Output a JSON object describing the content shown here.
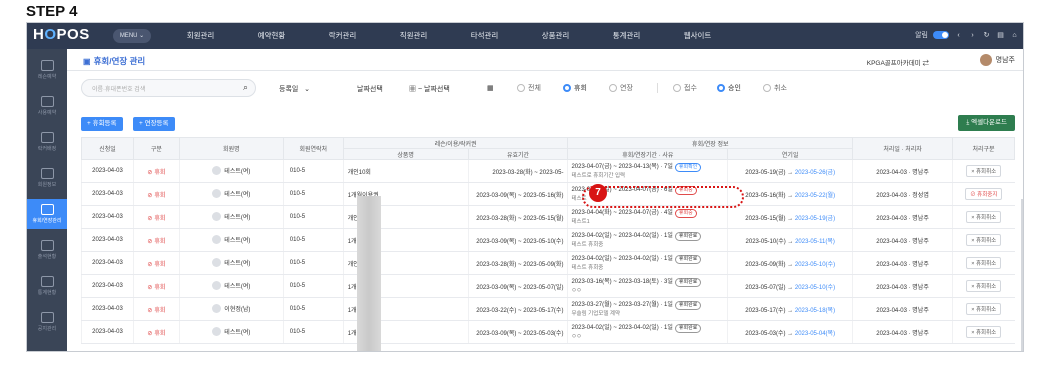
{
  "step_label": "STEP 4",
  "header": {
    "logo": "HOPOS",
    "menu_label": "MENU",
    "nav": [
      "회원관리",
      "예약현황",
      "락커관리",
      "직원관리",
      "타석관리",
      "상품관리",
      "통계관리",
      "웹사이트"
    ],
    "toggle_label": "알림"
  },
  "sidebar": {
    "items": [
      {
        "label": "레슨예약",
        "icon": "calendar-icon"
      },
      {
        "label": "사용예약",
        "icon": "document-icon"
      },
      {
        "label": "락커배정",
        "icon": "locker-icon"
      },
      {
        "label": "회원정보",
        "icon": "member-icon"
      },
      {
        "label": "휴회/연장관리",
        "icon": "pause-calendar-icon",
        "active": true
      },
      {
        "label": "출석현황",
        "icon": "check-icon"
      },
      {
        "label": "통계현황",
        "icon": "chart-icon"
      },
      {
        "label": "공지관리",
        "icon": "board-icon"
      },
      {
        "label": "문자관리",
        "icon": "megaphone-icon"
      }
    ]
  },
  "page": {
    "title": "휴회/연장 관리",
    "academy": "KPGA골프아카데미",
    "user": "명남주"
  },
  "filters": {
    "search_placeholder": "이름·휴대폰번호 검색",
    "sort": "등록일",
    "date_start": "날짜선택",
    "date_sep": "~",
    "date_end": "날짜선택",
    "type_options": [
      "전체",
      "휴회",
      "연장"
    ],
    "type_selected": "휴회",
    "status_options": [
      "접수",
      "승인",
      "취소"
    ],
    "status_selected": "승인"
  },
  "buttons": {
    "add_pause": "+ 휴회등록",
    "add_extend": "+ 연장등록",
    "excel": "엑셀다운로드"
  },
  "table": {
    "group_headers": {
      "lesson": "레슨/이용/락커권",
      "pause": "휴회/연장 정보"
    },
    "headers": [
      "신청일",
      "구분",
      "회원명",
      "회원연락처",
      "상품명",
      "유효기간",
      "휴회/연장기간 · 사유",
      "연기일",
      "처리일 · 처리자",
      "처리구분"
    ],
    "rows": [
      {
        "date": "2023-04-03",
        "type": "휴회",
        "member": "테스트(여)",
        "phone": "010-5",
        "product": "개인10회",
        "validity": "2023-03-28(화) ~ 2023-05-",
        "period": "2023-04-07(금) ~ 2023-04-13(목) · 7일",
        "chip": "휴회확인",
        "chip_color": "blue",
        "reason": "테스트로 휴회기간 입력",
        "postpone": "2023-05-19(금)",
        "postpone_to": "2023-05-26(금)",
        "processed": "2023-04-03 · 명남주",
        "action": "휴회취소",
        "stop": false
      },
      {
        "date": "2023-04-03",
        "type": "휴회",
        "member": "테스트(여)",
        "phone": "010-5",
        "product": "1개월이용권",
        "validity": "2023-03-09(목) ~ 2023-05-16(화)",
        "period": "2023-04-02(일) ~ 2023-04-07(금) · 6일",
        "chip": "휴회중",
        "chip_color": "red",
        "reason": "테스트",
        "postpone": "2023-05-16(화)",
        "postpone_to": "2023-05-22(월)",
        "processed": "2023-04-03 · 정성엽",
        "action": "휴회중지",
        "stop": true
      },
      {
        "date": "2023-04-03",
        "type": "휴회",
        "member": "테스트(여)",
        "phone": "010-5",
        "product": "개인10회",
        "validity": "2023-03-28(화) ~ 2023-05-15(월)",
        "period": "2023-04-04(화) ~ 2023-04-07(금) · 4일",
        "chip": "휴회중",
        "chip_color": "red",
        "reason": "테스트1",
        "postpone": "2023-05-15(월)",
        "postpone_to": "2023-05-19(금)",
        "processed": "2023-04-03 · 명남주",
        "action": "휴회취소",
        "stop": false
      },
      {
        "date": "2023-04-03",
        "type": "휴회",
        "member": "테스트(여)",
        "phone": "010-5",
        "product": "1개월이용권",
        "validity": "2023-03-09(목) ~ 2023-05-10(수)",
        "period": "2023-04-02(일) ~ 2023-04-02(일) · 1일",
        "chip": "휴회완료",
        "chip_color": "gray",
        "reason": "테스트 휴회중",
        "postpone": "2023-05-10(수)",
        "postpone_to": "2023-05-11(목)",
        "processed": "2023-04-03 · 명남주",
        "action": "휴회취소",
        "stop": false
      },
      {
        "date": "2023-04-03",
        "type": "휴회",
        "member": "테스트(여)",
        "phone": "010-5",
        "product": "개인10회",
        "validity": "2023-03-28(화) ~ 2023-05-09(화)",
        "period": "2023-04-02(일) ~ 2023-04-02(일) · 1일",
        "chip": "휴회완료",
        "chip_color": "gray",
        "reason": "테스트 휴회중",
        "postpone": "2023-05-09(화)",
        "postpone_to": "2023-05-10(수)",
        "processed": "2023-04-03 · 명남주",
        "action": "휴회취소",
        "stop": false
      },
      {
        "date": "2023-04-03",
        "type": "휴회",
        "member": "테스트(여)",
        "phone": "010-5",
        "product": "1개월이용권",
        "validity": "2023-03-09(목) ~ 2023-05-07(일)",
        "period": "2023-03-16(목) ~ 2023-03-18(토) · 3일",
        "chip": "휴회완료",
        "chip_color": "gray",
        "reason": "ㅇㅇ",
        "postpone": "2023-05-07(일)",
        "postpone_to": "2023-05-10(수)",
        "processed": "2023-04-03 · 명남주",
        "action": "휴회취소",
        "stop": false
      },
      {
        "date": "2023-04-03",
        "type": "휴회",
        "member": "이현정(남)",
        "phone": "010-5",
        "product": "1개월이용권",
        "validity": "2023-03-22(수) ~ 2023-05-17(수)",
        "period": "2023-03-27(월) ~ 2023-03-27(월) · 1일",
        "chip": "휴회완료",
        "chip_color": "gray",
        "reason": "무슬림 기업모델 계약",
        "postpone": "2023-05-17(수)",
        "postpone_to": "2023-05-18(목)",
        "processed": "2023-04-03 · 명남주",
        "action": "휴회취소",
        "stop": false
      },
      {
        "date": "2023-04-03",
        "type": "휴회",
        "member": "테스트(여)",
        "phone": "010-5",
        "product": "1개월이용권",
        "validity": "2023-03-09(목) ~ 2023-05-03(수)",
        "period": "2023-04-02(일) ~ 2023-04-02(일) · 1일",
        "chip": "휴회완료",
        "chip_color": "gray",
        "reason": "ㅇㅇ",
        "postpone": "2023-05-03(수)",
        "postpone_to": "2023-05-04(목)",
        "processed": "2023-04-03 · 명남주",
        "action": "휴회취소",
        "stop": false
      }
    ]
  },
  "annotation": {
    "number": "7"
  }
}
